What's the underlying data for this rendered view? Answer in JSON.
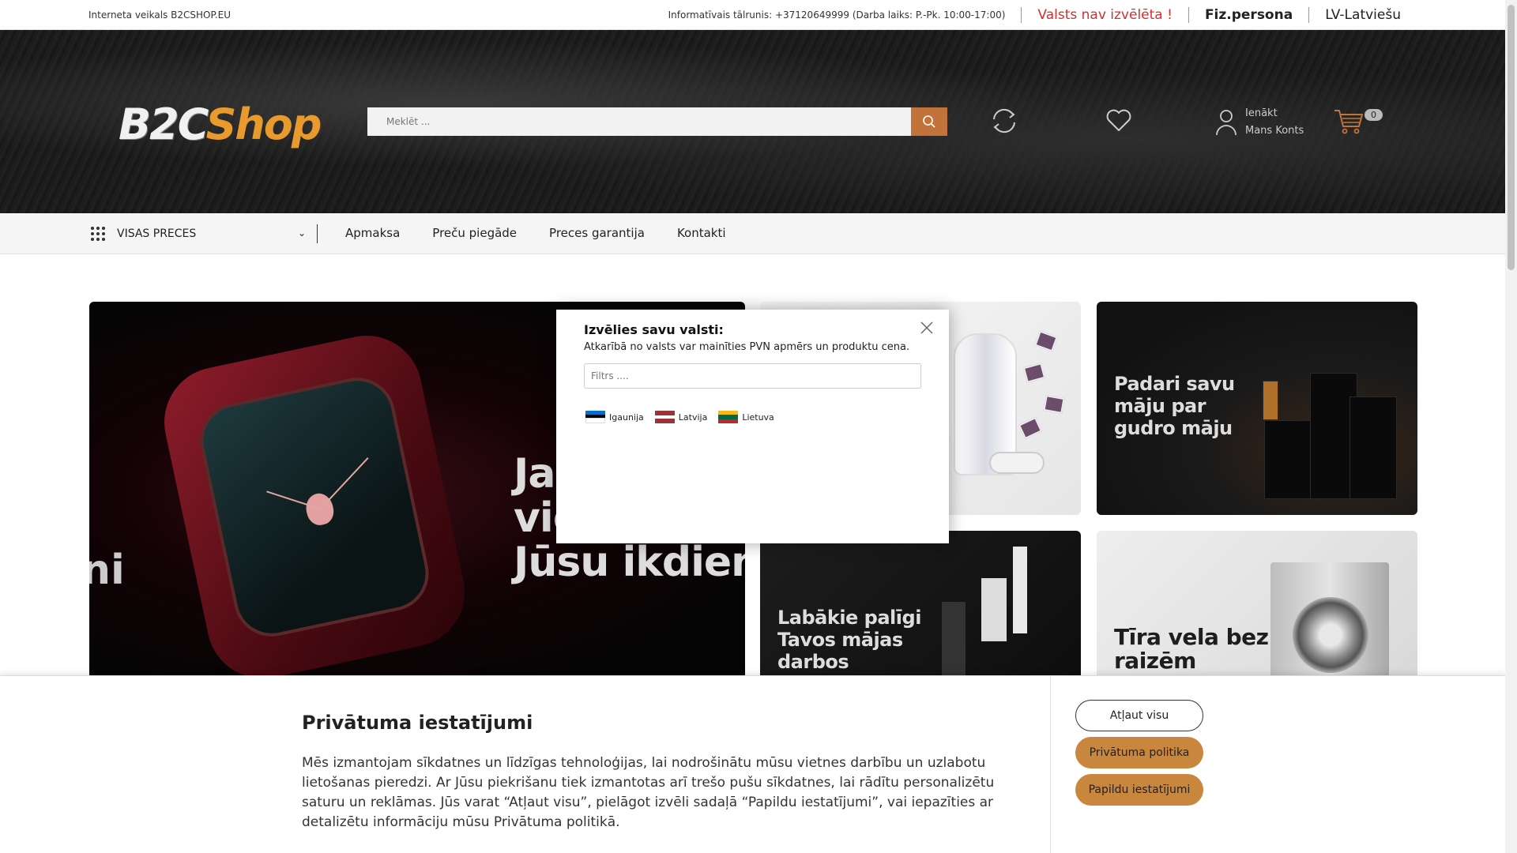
{
  "topbar": {
    "site_name": "Interneta veikals B2CSHOP.EU",
    "phone_info": "Informatīvais tālrunis: +37120649999 (Darba laiks: P.-Pk. 10:00-17:00)",
    "country_status": "Valsts nav izvēlēta !",
    "persona": "Fiz.persona",
    "language": "LV-Latviešu"
  },
  "header": {
    "logo_part1": "B2C",
    "logo_part2": "Shop",
    "search_placeholder": "Meklēt ...",
    "account_line1": "Ienākt",
    "account_line2": "Mans Konts",
    "cart_count": "0"
  },
  "nav": {
    "all_products": "VISAS PRECES",
    "links": [
      "Apmaksa",
      "Preču piegāde",
      "Preces garantija",
      "Kontakti"
    ]
  },
  "banners": {
    "main_text_line1": "Ja",
    "main_text_line2": "vie",
    "main_text_line3": "Jūsu ikdiena",
    "main_left_fragment": "ni",
    "home_text": "Padari savu māju par gudro māju",
    "vacuum_text": "Labākie palīgi Tavos mājas darbos",
    "washer_text": "Tīra vela bez raizēm"
  },
  "modal": {
    "title": "Izvēlies savu valsti:",
    "subtitle": "Atkarībā no valsts var mainīties PVN apmērs un produktu cena.",
    "filter_placeholder": "Filtrs ....",
    "countries": [
      "Igaunija",
      "Latvija",
      "Lietuva"
    ]
  },
  "cookie": {
    "title": "Privātuma iestatījumi",
    "text": "Mēs izmantojam sīkdatnes un līdzīgas tehnoloģijas, lai nodrošinātu mūsu vietnes darbību un uzlabotu lietošanas pieredzi. Ar Jūsu piekrišanu tiek izmantotas arī trešo pušu sīkdatnes, lai rādītu personalizētu saturu un reklāmas. Jūs varat “Atļaut visu”, pielāgot izvēli sadaļā “Papildu iestatījumi”, vai iepazīties ar detalizētu informāciju mūsu Privātuma politikā.",
    "allow_all": "Atļaut visu",
    "privacy_policy": "Privātuma politika",
    "more_settings": "Papildu iestatījumi"
  },
  "colors": {
    "accent": "#c8873c",
    "country_warning": "#d32f2f",
    "logo_orange": "#e89a2c"
  }
}
